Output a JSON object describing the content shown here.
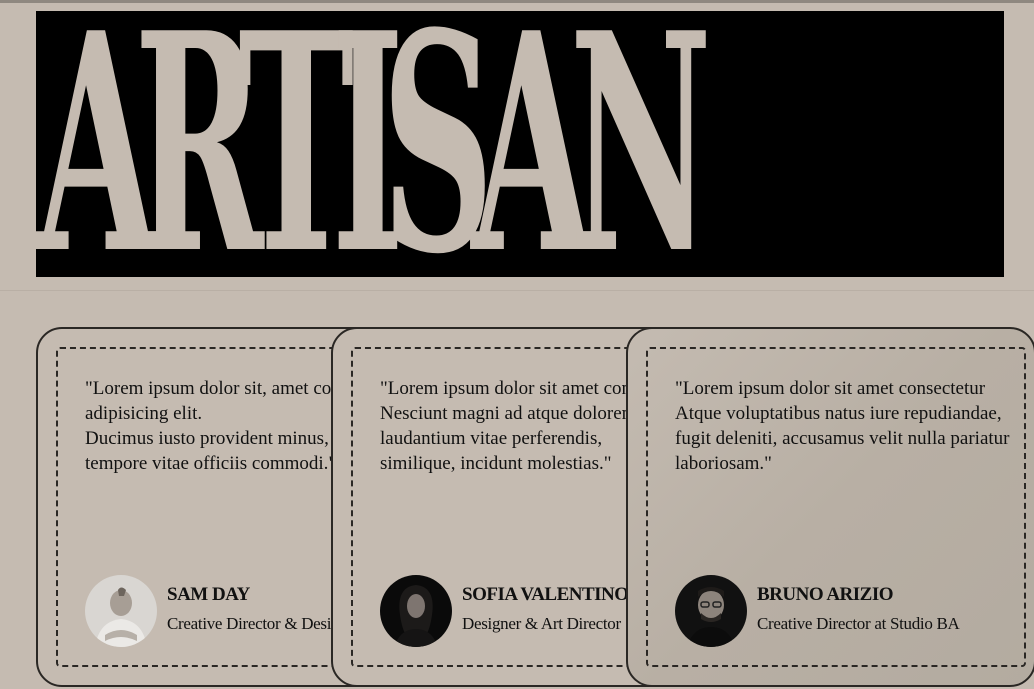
{
  "hero": {
    "title": "ARTISAN"
  },
  "testimonials": [
    {
      "quote": "\"Lorem ipsum dolor sit, amet consectetur adipisicing elit.\nDucimus iusto provident minus,\ntempore vitae officiis commodi.\"",
      "name": "SAM DAY",
      "role": "Creative Director & Designer",
      "avatar_icon": "avatar-photo-sam"
    },
    {
      "quote": "\"Lorem ipsum dolor sit amet consectetur.\nNesciunt magni ad atque dolorem,\nlaudantium vitae perferendis,\nsimilique, incidunt molestias.\"",
      "name": "SOFIA VALENTINO",
      "role": "Designer & Art Director",
      "avatar_icon": "avatar-photo-sofia"
    },
    {
      "quote": "\"Lorem ipsum dolor sit amet consectetur\nAtque voluptatibus natus iure repudiandae,\nfugit deleniti, accusamus velit nulla pariatur\nlaboriosam.\"",
      "name": "BRUNO ARIZIO",
      "role": "Creative Director at Studio BA",
      "avatar_icon": "avatar-photo-bruno"
    }
  ],
  "colors": {
    "background": "#c5bbb1",
    "hero_block": "#000000",
    "text": "#111111",
    "card_border": "#2a2724"
  }
}
